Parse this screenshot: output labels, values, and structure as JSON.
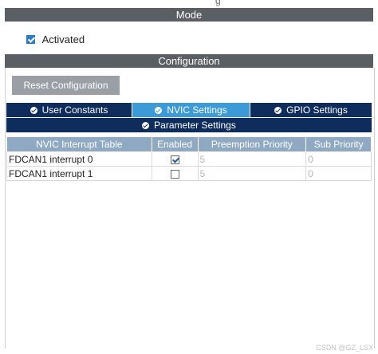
{
  "top_cut_text": "g",
  "mode": {
    "title": "Mode",
    "activated_label": "Activated",
    "activated_checked": true
  },
  "configuration": {
    "title": "Configuration",
    "reset_button": "Reset Configuration",
    "tabs": [
      {
        "label": "User Constants",
        "active": false
      },
      {
        "label": "NVIC Settings",
        "active": true
      },
      {
        "label": "GPIO Settings",
        "active": false
      }
    ],
    "tab_row2": {
      "label": "Parameter Settings"
    },
    "table": {
      "headers": [
        "NVIC Interrupt Table",
        "Enabled",
        "Preemption Priority",
        "Sub Priority"
      ],
      "rows": [
        {
          "name": "FDCAN1 interrupt 0",
          "enabled": true,
          "preemption": "5",
          "sub": "0"
        },
        {
          "name": "FDCAN1 interrupt 1",
          "enabled": false,
          "preemption": "5",
          "sub": "0"
        }
      ]
    }
  },
  "watermark": "CSDN @GZ_LSX",
  "colors": {
    "section_bar": "#5b5e63",
    "tab_dark": "#0f2d5c",
    "tab_active": "#3c9bd6",
    "table_header": "#8ea9c1",
    "reset_button": "#9a9fa6",
    "checkbox_blue": "#2d7cc4"
  }
}
